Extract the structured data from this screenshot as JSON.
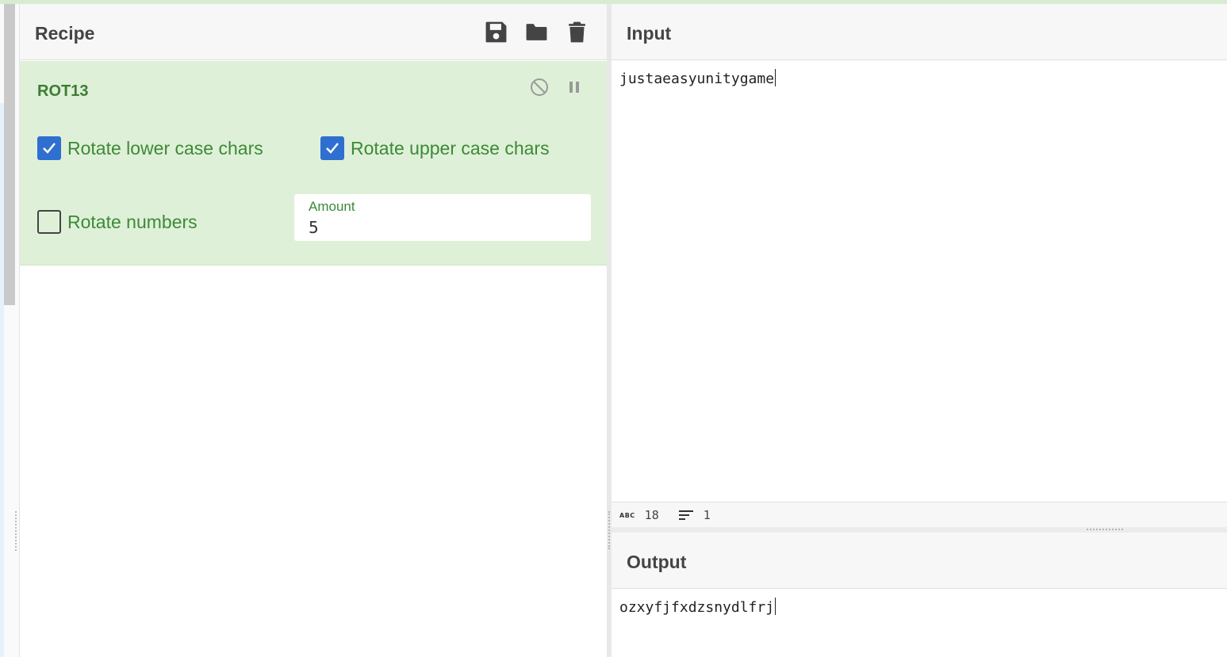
{
  "recipe": {
    "title": "Recipe",
    "icons": [
      "save-icon",
      "folder-icon",
      "trash-icon"
    ]
  },
  "operation": {
    "name": "ROT13",
    "options": {
      "rotate_lower": {
        "label": "Rotate lower case chars",
        "checked": true
      },
      "rotate_upper": {
        "label": "Rotate upper case chars",
        "checked": true
      },
      "rotate_numbers": {
        "label": "Rotate numbers",
        "checked": false
      }
    },
    "amount": {
      "label": "Amount",
      "value": "5"
    }
  },
  "input": {
    "title": "Input",
    "text": "justaeasyunitygame",
    "stats": {
      "length": "18",
      "lines": "1"
    }
  },
  "output": {
    "title": "Output",
    "text": "ozxyfjfxdzsnydlfrj"
  },
  "colors": {
    "accent_green": "#3c8a37",
    "operation_bg": "#dff0d8",
    "checkbox_blue": "#2f6fd0"
  }
}
